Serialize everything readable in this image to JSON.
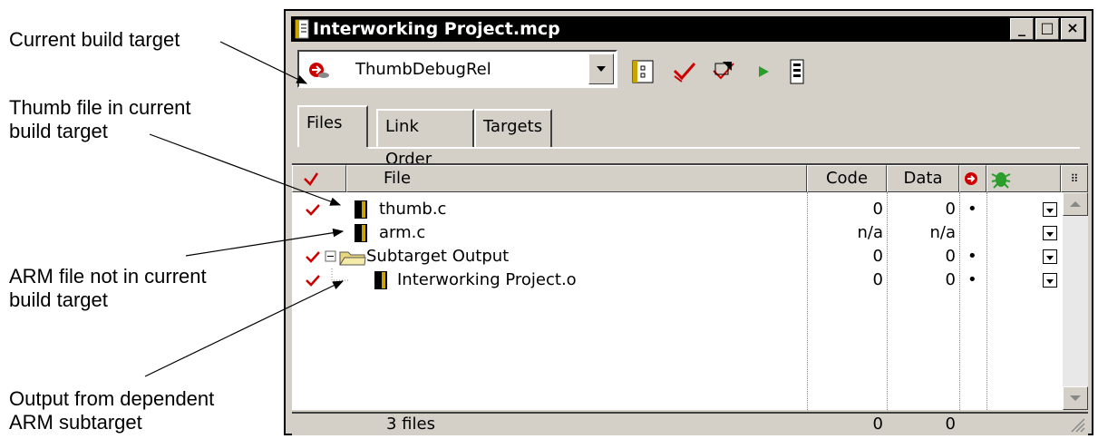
{
  "callouts": {
    "current_target": "Current build target",
    "thumb_line1": "Thumb file in current",
    "thumb_line2": "build target",
    "arm_line1": "ARM file not in current",
    "arm_line2": "build target",
    "output_line1": "Output from dependent",
    "output_line2": "ARM subtarget"
  },
  "window": {
    "title": "Interworking Project.mcp",
    "minimize": "_",
    "maximize": "□",
    "close": "×"
  },
  "toolbar": {
    "target_selected": "ThumbDebugRel",
    "tools": [
      "target-settings-icon",
      "check-syntax-icon",
      "make-icon",
      "run-icon",
      "debug-icon"
    ]
  },
  "tabs": [
    "Files",
    "Link Order",
    "Targets"
  ],
  "columns": {
    "file": "File",
    "code": "Code",
    "data": "Data"
  },
  "files": [
    {
      "name": "thumb.c",
      "code": "0",
      "data": "0",
      "in_target": true,
      "debug": true
    },
    {
      "name": "arm.c",
      "code": "n/a",
      "data": "n/a",
      "in_target": false,
      "debug": false
    },
    {
      "name": "Subtarget Output",
      "code": "0",
      "data": "0",
      "in_target": true,
      "debug": true
    },
    {
      "name": "Interworking Project.o",
      "code": "0",
      "data": "0",
      "in_target": true,
      "debug": true
    }
  ],
  "status": {
    "count": "3 files",
    "code_total": "0",
    "data_total": "0"
  }
}
